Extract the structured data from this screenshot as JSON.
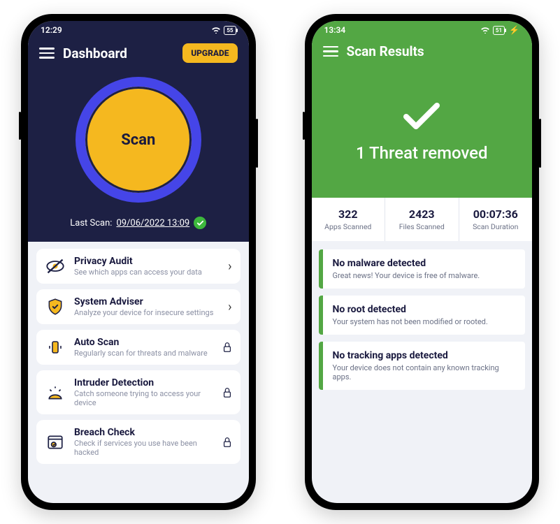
{
  "left": {
    "status": {
      "time": "12:29",
      "battery": "55"
    },
    "header": {
      "title": "Dashboard",
      "upgrade": "UPGRADE"
    },
    "scan": {
      "label": "Scan"
    },
    "lastScan": {
      "prefix": "Last Scan:",
      "value": "09/06/2022 13:09"
    },
    "features": [
      {
        "title": "Privacy Audit",
        "desc": "See which apps can access your data",
        "trailing": "chevron"
      },
      {
        "title": "System Adviser",
        "desc": "Analyze your device for insecure settings",
        "trailing": "chevron"
      },
      {
        "title": "Auto Scan",
        "desc": "Regularly scan for threats and malware",
        "trailing": "lock"
      },
      {
        "title": "Intruder Detection",
        "desc": "Catch someone trying to access your device",
        "trailing": "lock"
      },
      {
        "title": "Breach Check",
        "desc": "Check if services you use have been hacked",
        "trailing": "lock"
      }
    ]
  },
  "right": {
    "status": {
      "time": "13:34",
      "battery": "51"
    },
    "header": {
      "title": "Scan Results"
    },
    "hero": "1 Threat removed",
    "stats": [
      {
        "value": "322",
        "label": "Apps Scanned"
      },
      {
        "value": "2423",
        "label": "Files Scanned"
      },
      {
        "value": "00:07:36",
        "label": "Scan Duration"
      }
    ],
    "results": [
      {
        "title": "No malware detected",
        "desc": "Great news! Your device is free of malware."
      },
      {
        "title": "No root detected",
        "desc": "Your system has not been modified or rooted."
      },
      {
        "title": "No tracking apps detected",
        "desc": "Your device does not contain any known tracking apps."
      }
    ]
  }
}
